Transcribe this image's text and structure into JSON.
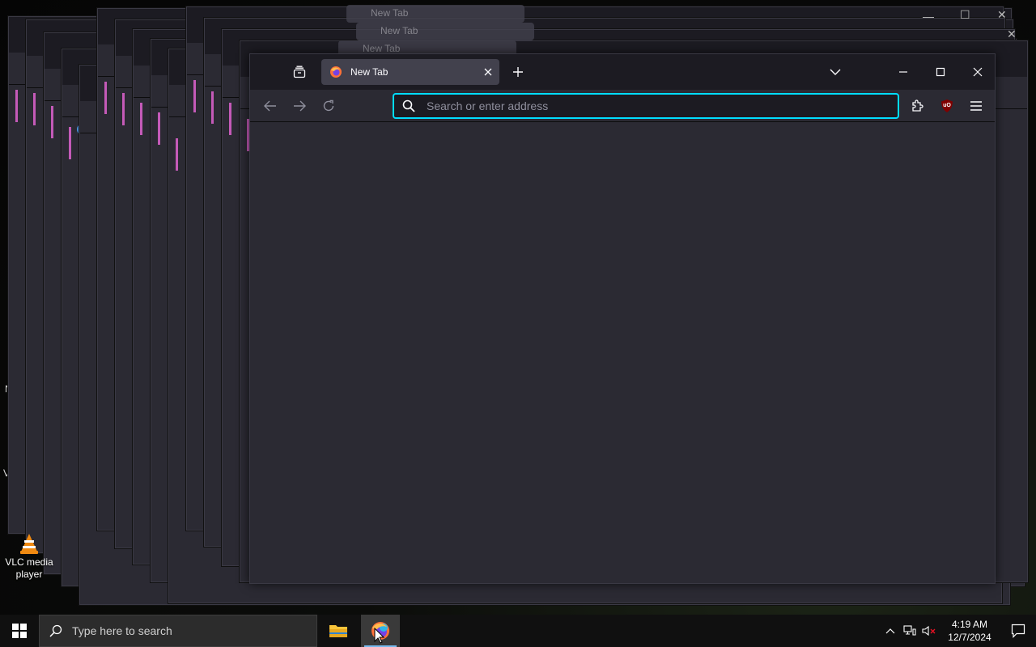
{
  "desktop": {
    "vlc_label": "VLC media player",
    "fragments": [
      "V",
      "N"
    ]
  },
  "ghost_tab_label": "New Tab",
  "browser": {
    "tab_title": "New Tab",
    "url_placeholder": "Search or enter address",
    "extension_badge": "uO",
    "accent_color": "#00ddff"
  },
  "taskbar": {
    "search_placeholder": "Type here to search",
    "time": "4:19 AM",
    "date": "12/7/2024"
  }
}
